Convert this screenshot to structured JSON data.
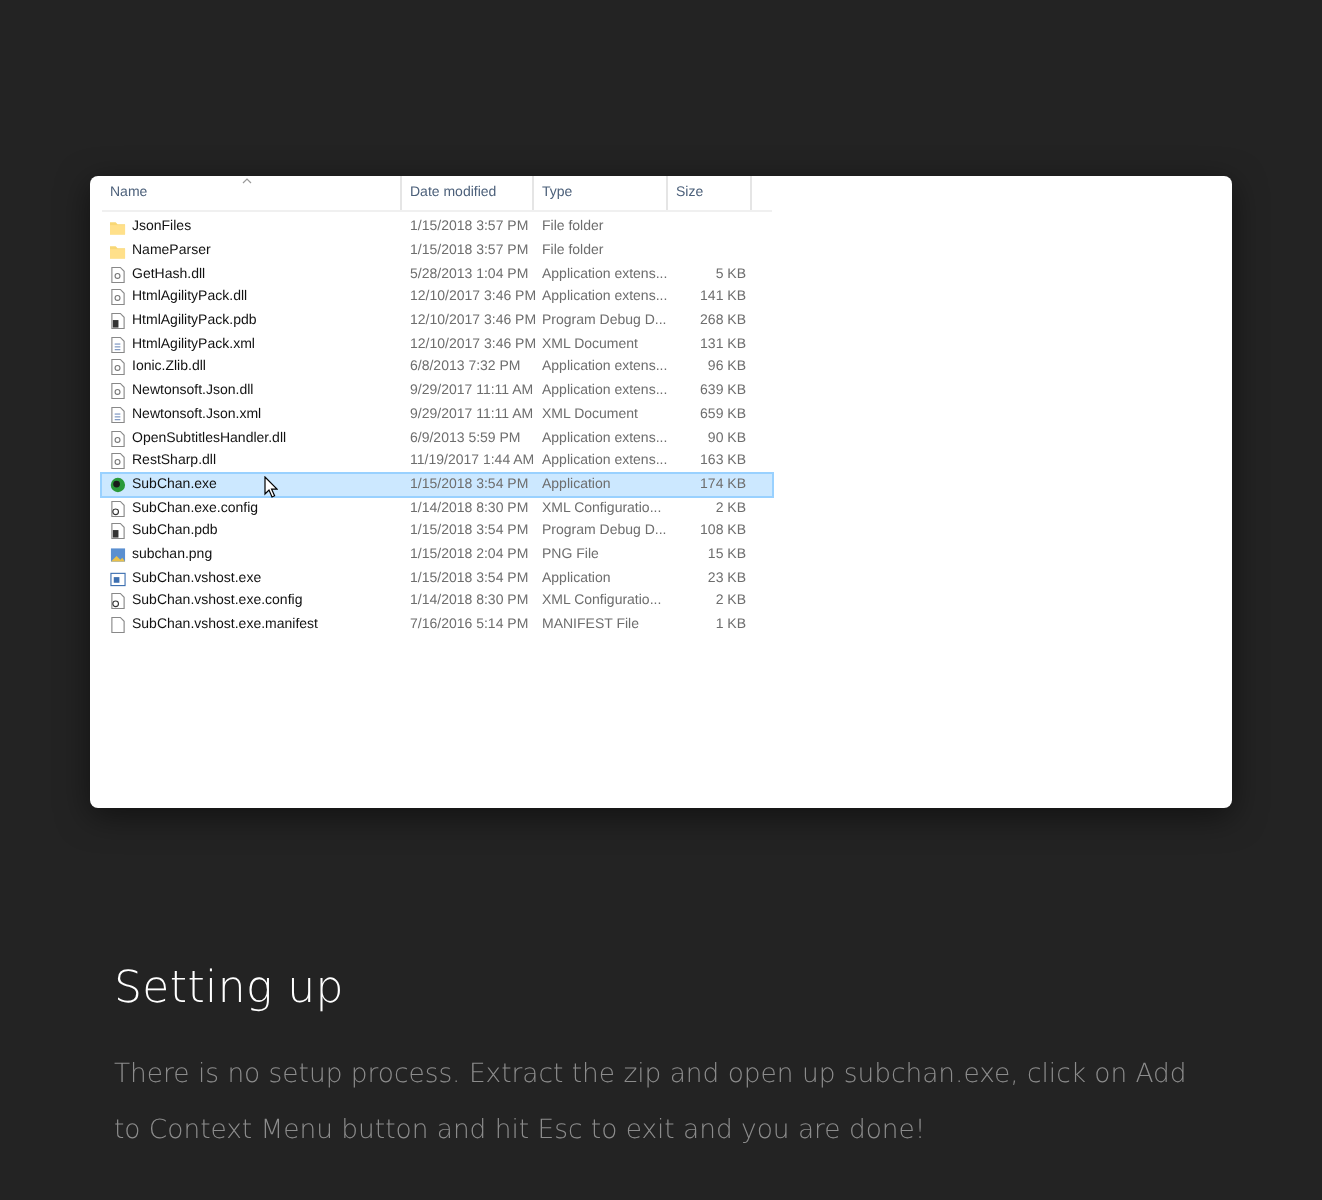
{
  "file_list": {
    "columns": [
      "Name",
      "Date modified",
      "Type",
      "Size"
    ],
    "rows": [
      {
        "kind": "folder",
        "name": "JsonFiles",
        "date": "1/15/2018 3:57 PM",
        "type": "File folder",
        "size": "",
        "selected": false
      },
      {
        "kind": "folder",
        "name": "NameParser",
        "date": "1/15/2018 3:57 PM",
        "type": "File folder",
        "size": "",
        "selected": false
      },
      {
        "kind": "dll",
        "name": "GetHash.dll",
        "date": "5/28/2013 1:04 PM",
        "type": "Application extens...",
        "size": "5 KB",
        "selected": false
      },
      {
        "kind": "dll",
        "name": "HtmlAgilityPack.dll",
        "date": "12/10/2017 3:46 PM",
        "type": "Application extens...",
        "size": "141 KB",
        "selected": false
      },
      {
        "kind": "pdb",
        "name": "HtmlAgilityPack.pdb",
        "date": "12/10/2017 3:46 PM",
        "type": "Program Debug D...",
        "size": "268 KB",
        "selected": false
      },
      {
        "kind": "xml",
        "name": "HtmlAgilityPack.xml",
        "date": "12/10/2017 3:46 PM",
        "type": "XML Document",
        "size": "131 KB",
        "selected": false
      },
      {
        "kind": "dll",
        "name": "Ionic.Zlib.dll",
        "date": "6/8/2013 7:32 PM",
        "type": "Application extens...",
        "size": "96 KB",
        "selected": false
      },
      {
        "kind": "dll",
        "name": "Newtonsoft.Json.dll",
        "date": "9/29/2017 11:11 AM",
        "type": "Application extens...",
        "size": "639 KB",
        "selected": false
      },
      {
        "kind": "xml",
        "name": "Newtonsoft.Json.xml",
        "date": "9/29/2017 11:11 AM",
        "type": "XML Document",
        "size": "659 KB",
        "selected": false
      },
      {
        "kind": "dll",
        "name": "OpenSubtitlesHandler.dll",
        "date": "6/9/2013 5:59 PM",
        "type": "Application extens...",
        "size": "90 KB",
        "selected": false
      },
      {
        "kind": "dll",
        "name": "RestSharp.dll",
        "date": "11/19/2017 1:44 AM",
        "type": "Application extens...",
        "size": "163 KB",
        "selected": false
      },
      {
        "kind": "app",
        "name": "SubChan.exe",
        "date": "1/15/2018 3:54 PM",
        "type": "Application",
        "size": "174 KB",
        "selected": true
      },
      {
        "kind": "config",
        "name": "SubChan.exe.config",
        "date": "1/14/2018 8:30 PM",
        "type": "XML Configuratio...",
        "size": "2 KB",
        "selected": false
      },
      {
        "kind": "pdb",
        "name": "SubChan.pdb",
        "date": "1/15/2018 3:54 PM",
        "type": "Program Debug D...",
        "size": "108 KB",
        "selected": false
      },
      {
        "kind": "png",
        "name": "subchan.png",
        "date": "1/15/2018 2:04 PM",
        "type": "PNG File",
        "size": "15 KB",
        "selected": false
      },
      {
        "kind": "exe",
        "name": "SubChan.vshost.exe",
        "date": "1/15/2018 3:54 PM",
        "type": "Application",
        "size": "23 KB",
        "selected": false
      },
      {
        "kind": "config",
        "name": "SubChan.vshost.exe.config",
        "date": "1/14/2018 8:30 PM",
        "type": "XML Configuratio...",
        "size": "2 KB",
        "selected": false
      },
      {
        "kind": "manifest",
        "name": "SubChan.vshost.exe.manifest",
        "date": "7/16/2016 5:14 PM",
        "type": "MANIFEST File",
        "size": "1 KB",
        "selected": false
      }
    ]
  },
  "section": {
    "heading": "Setting up",
    "body": "There is no setup process. Extract the zip and open up subchan.exe, click on Add to Context Menu button and hit Esc to exit and you are done!"
  }
}
